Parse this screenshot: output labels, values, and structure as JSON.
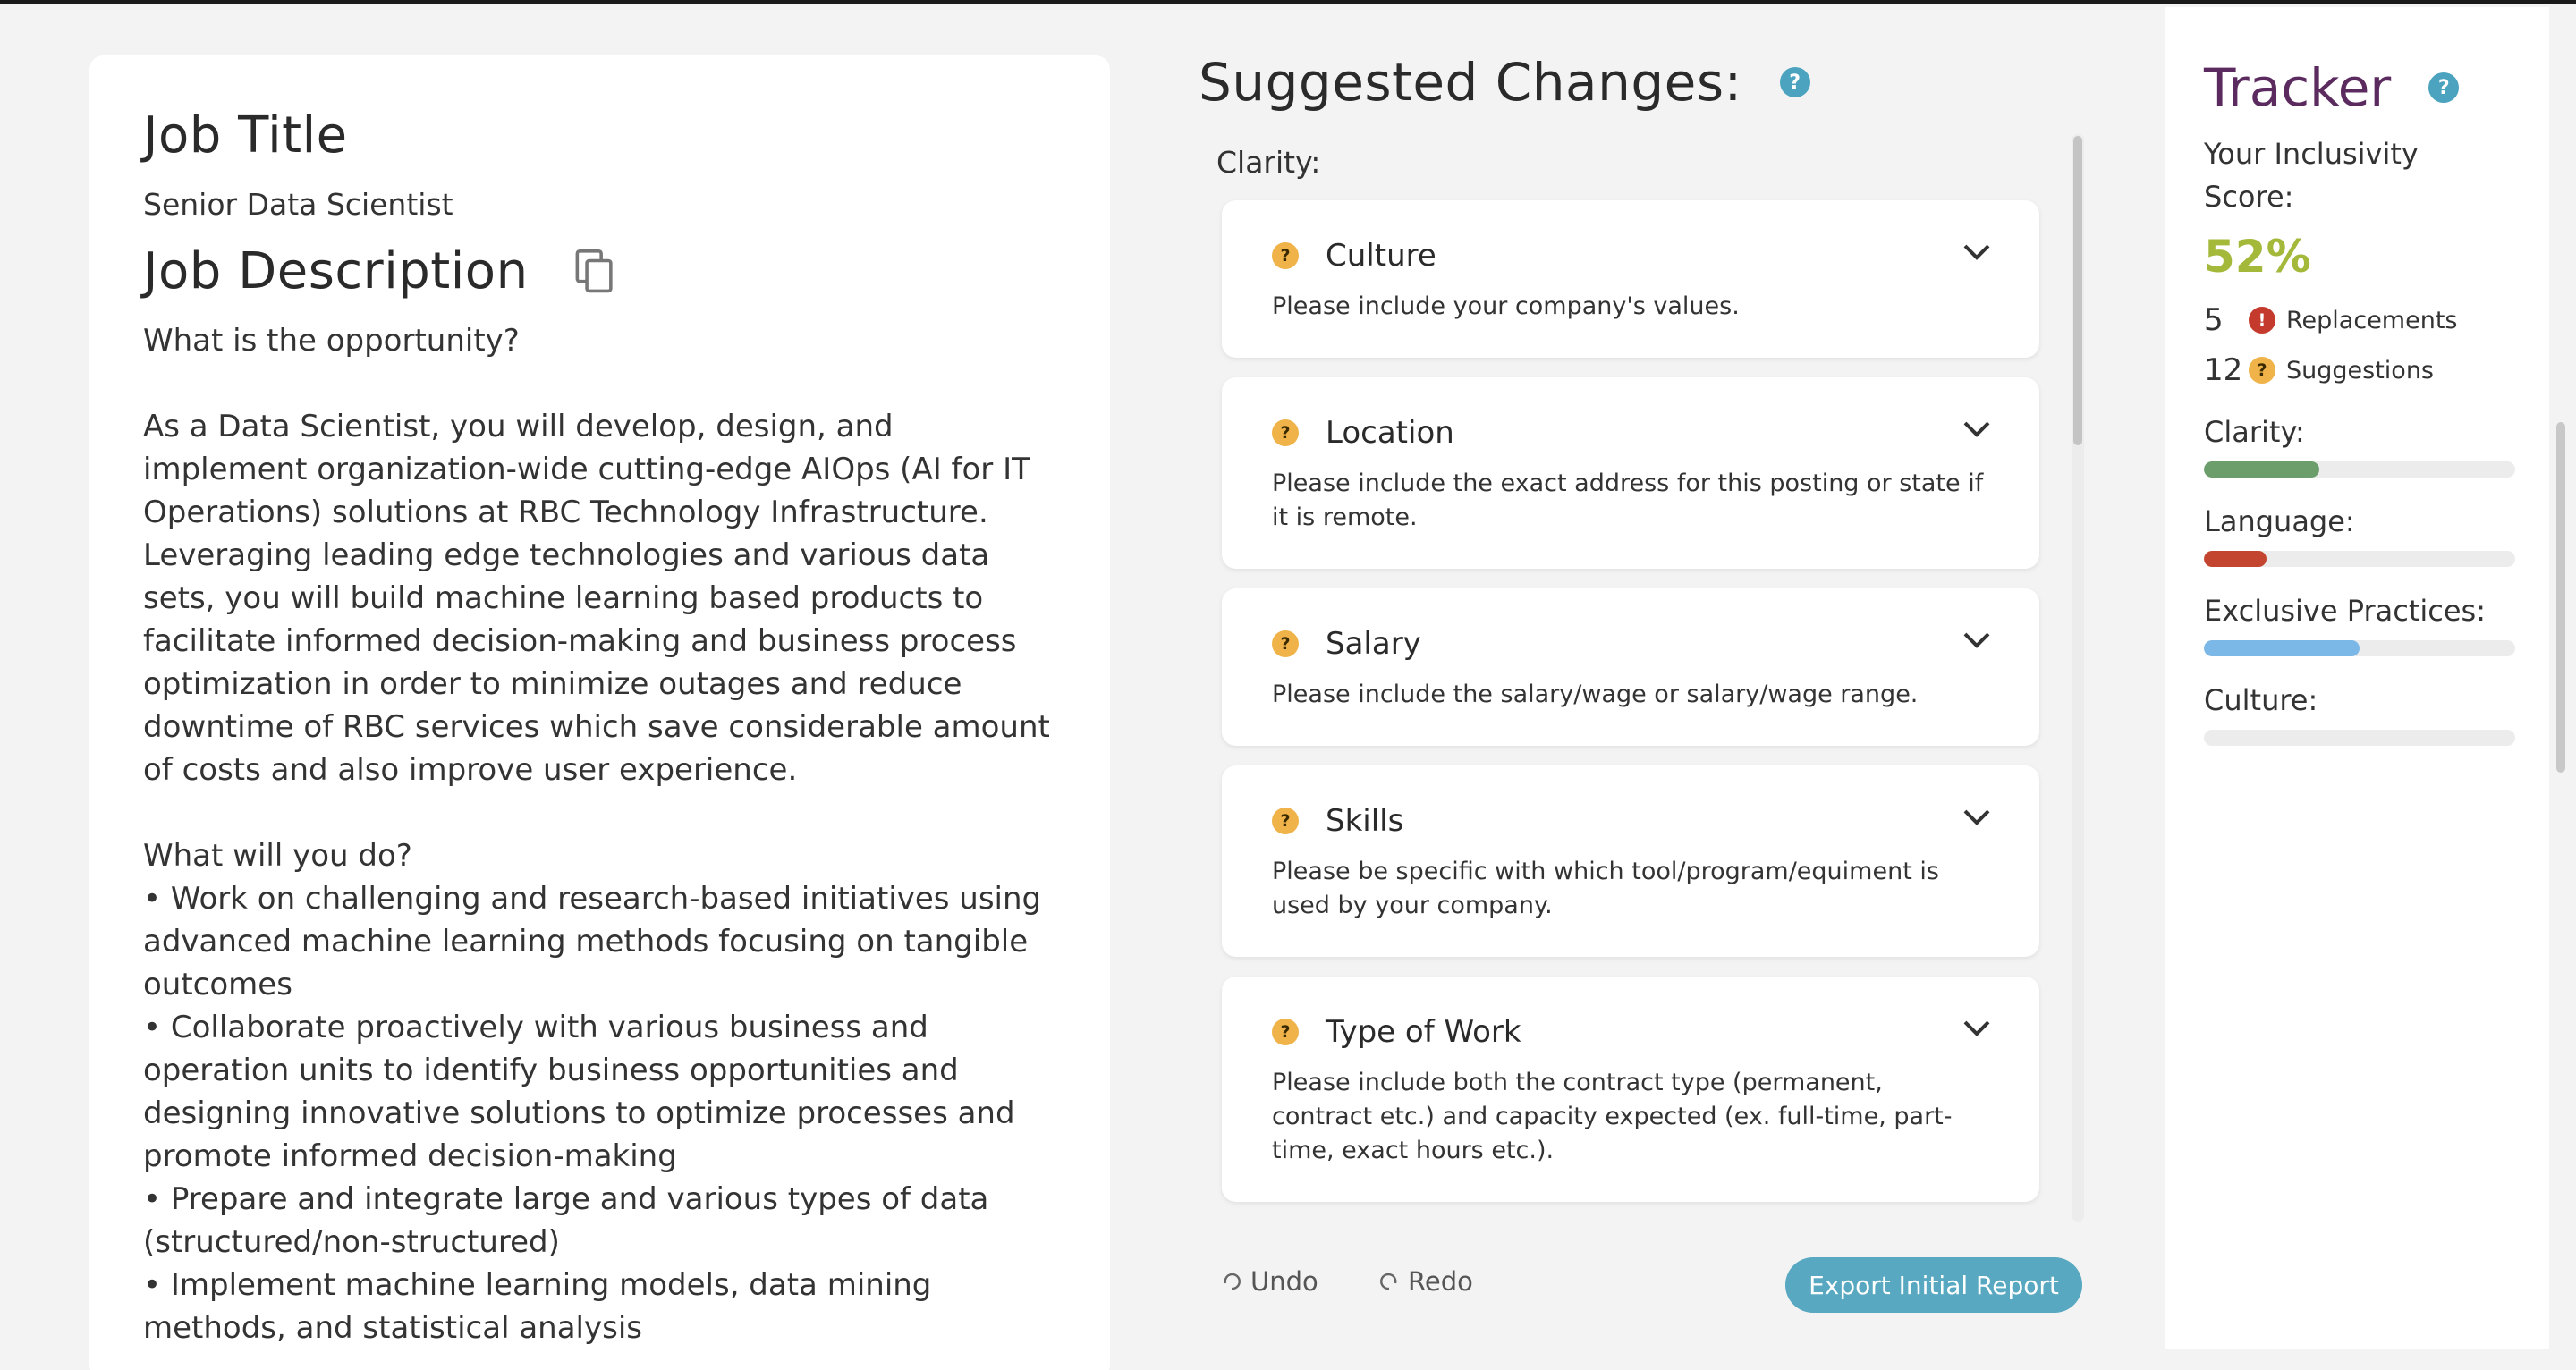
{
  "job": {
    "title_heading": "Job Title",
    "title_value": "Senior Data Scientist",
    "description_heading": "Job Description",
    "description": {
      "q1": "What is the opportunity?",
      "para1": "As a Data Scientist, you will develop, design, and implement organization-wide cutting-edge AIOps (AI for IT Operations) solutions at RBC Technology Infrastructure. Leveraging leading edge technologies and various data sets, you will build machine learning based products to facilitate informed decision-making and business process optimization in order to minimize outages and reduce downtime of RBC services which save considerable amount of costs and also improve user experience.",
      "q2": "What will you do?",
      "bullets": [
        "• Work on challenging and research-based initiatives using advanced machine learning methods focusing on tangible outcomes",
        "• Collaborate proactively with various business and operation units to identify business opportunities and designing innovative solutions to optimize processes and promote informed decision-making",
        "• Prepare and integrate large and various types of data (structured/non-structured)",
        "• Implement machine learning models, data mining methods, and statistical analysis"
      ]
    }
  },
  "suggestions": {
    "heading": "Suggested Changes:",
    "section_label": "Clarity:",
    "items": [
      {
        "title": "Culture",
        "text": "Please include your company's values."
      },
      {
        "title": "Location",
        "text": "Please include the exact address for this posting or state if it is remote."
      },
      {
        "title": "Salary",
        "text": "Please include the salary/wage or salary/wage range."
      },
      {
        "title": "Skills",
        "text": "Please be specific with which tool/program/equiment is used by your company."
      },
      {
        "title": "Type of Work",
        "text": "Please include both the contract type (permanent, contract etc.) and capacity expected (ex. full-time, part-time, exact hours etc.)."
      }
    ],
    "undo_label": "Undo",
    "redo_label": "Redo",
    "export_label": "Export Initial Report"
  },
  "tracker": {
    "title": "Tracker",
    "score_label": "Your Inclusivity Score:",
    "score": "52%",
    "replacements_count": "5",
    "replacements_label": "Replacements",
    "suggestions_count": "12",
    "suggestions_label": "Suggestions",
    "metrics": [
      {
        "label": "Clarity:",
        "fill": 0.37,
        "color": "#6b9e6b"
      },
      {
        "label": "Language:",
        "fill": 0.2,
        "color": "#c4452f"
      },
      {
        "label": "Exclusive Practices:",
        "fill": 0.5,
        "color": "#7bb8e8"
      },
      {
        "label": "Culture:",
        "fill": 0,
        "color": "#cccccc"
      }
    ]
  },
  "icons": {
    "help": "?",
    "suggestion_badge": "?",
    "replacement_badge": "!"
  }
}
